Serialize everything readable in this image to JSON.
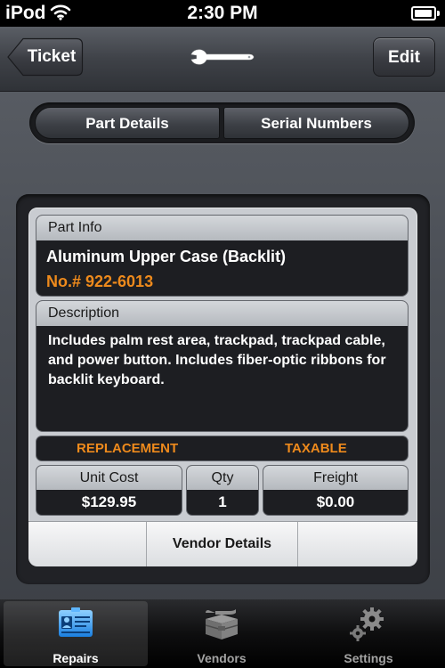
{
  "status_bar": {
    "carrier": "iPod",
    "time": "2:30 PM"
  },
  "nav": {
    "back_label": "Ticket",
    "edit_label": "Edit",
    "center_icon": "wrench-icon"
  },
  "segments": [
    {
      "label": "Part Details",
      "selected": true
    },
    {
      "label": "Serial Numbers",
      "selected": false
    }
  ],
  "part_info": {
    "header": "Part Info",
    "name": "Aluminum Upper Case (Backlit)",
    "number": "No.# 922-6013"
  },
  "description": {
    "header": "Description",
    "text": "Includes palm rest area, trackpad, trackpad cable, and power button. Includes fiber-optic ribbons for backlit keyboard."
  },
  "flags": {
    "replacement": "REPLACEMENT",
    "taxable": "TAXABLE"
  },
  "costs": {
    "unit_cost": {
      "label": "Unit Cost",
      "value": "$129.95"
    },
    "qty": {
      "label": "Qty",
      "value": "1"
    },
    "freight": {
      "label": "Freight",
      "value": "$0.00"
    }
  },
  "vendor_details_label": "Vendor Details",
  "tabs": [
    {
      "label": "Repairs",
      "icon": "id-card-icon",
      "selected": true
    },
    {
      "label": "Vendors",
      "icon": "toolbox-icon",
      "selected": false
    },
    {
      "label": "Settings",
      "icon": "gears-icon",
      "selected": false
    }
  ],
  "colors": {
    "accent_orange": "#ee8a1c",
    "panel_dark": "#1d1e22",
    "header_gray": "#c9ccd1"
  }
}
